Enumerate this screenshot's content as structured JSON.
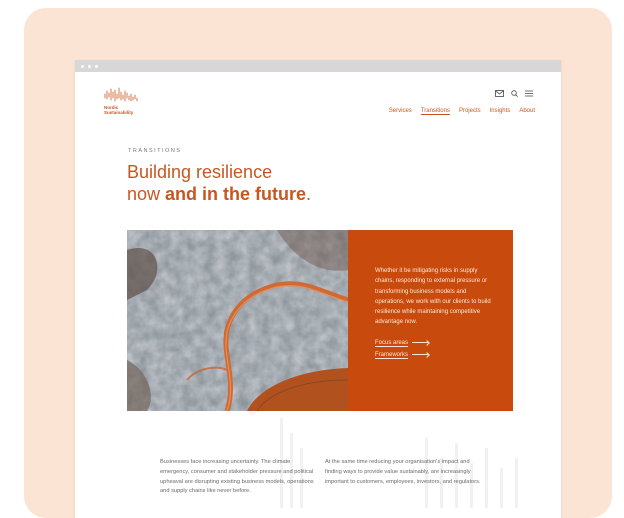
{
  "brand": {
    "name_line1": "Nordic",
    "name_line2": "Sustainability",
    "accent": "#c8571f",
    "hero_bg": "#c84a0c"
  },
  "header": {
    "icons": [
      "mail-icon",
      "search-icon",
      "menu-icon"
    ],
    "nav": [
      {
        "label": "Services",
        "active": false
      },
      {
        "label": "Transitions",
        "active": true
      },
      {
        "label": "Projects",
        "active": false
      },
      {
        "label": "Insights",
        "active": false
      },
      {
        "label": "About",
        "active": false
      }
    ]
  },
  "page": {
    "eyebrow": "TRANSITIONS",
    "title_line1": "Building resilience",
    "title_line2_plain": "now ",
    "title_line2_bold": "and in the future",
    "title_period": "."
  },
  "hero": {
    "text": "Whether it be mitigating risks in supply chains, responding to external pressure or transforming business models and operations, we work with our clients to build resilience while maintaining competitive advantage now.",
    "links": [
      "Focus areas",
      "Frameworks"
    ]
  },
  "body": {
    "col1": "Businesses face increasing uncertainty. The climate emergency, consumer and stakeholder pressure and political upheaval are disrupting existing business models, operations and supply chains like never before.",
    "col2": "At the same time reducing your organisation's impact and finding ways to provide value sustainably, are increasingly important to customers, employees, investors, and regulators."
  }
}
